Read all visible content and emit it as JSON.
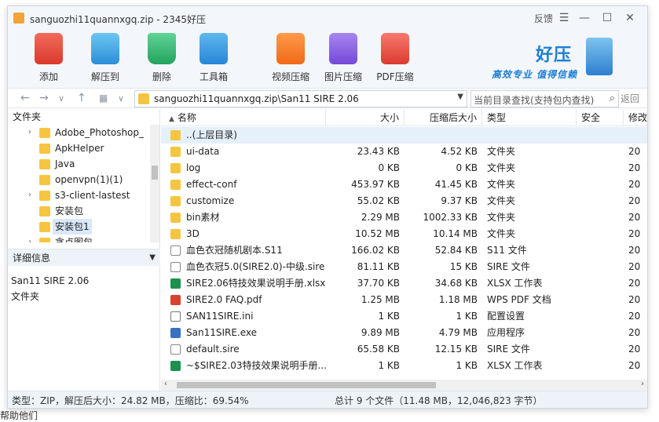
{
  "window": {
    "title": "sanguozhi11quannxgq.zip - 2345好压",
    "feedback": "反馈"
  },
  "toolbar": {
    "items": [
      {
        "label": "添加",
        "icon": "add-icon",
        "color": "#e1483a"
      },
      {
        "label": "解压到",
        "icon": "extract-icon",
        "color": "#37a3e6"
      },
      {
        "label": "删除",
        "icon": "recycle-icon",
        "color": "#2fb36b"
      },
      {
        "label": "工具箱",
        "icon": "toolbox-icon",
        "color": "#2f9be0"
      },
      {
        "label": "视频压缩",
        "icon": "video-compress-icon",
        "color": "#f0701e"
      },
      {
        "label": "图片压缩",
        "icon": "image-compress-icon",
        "color": "#8a5be0"
      },
      {
        "label": "PDF压缩",
        "icon": "pdf-compress-icon",
        "color": "#e6453b"
      }
    ],
    "brand": {
      "name": "好压",
      "slogan": "高效专业 值得信赖"
    }
  },
  "address": {
    "path": "sanguozhi11quannxgq.zip\\San11 SIRE 2.06",
    "search_placeholder": "当前目录查找(支持包内查找)",
    "back_label": "返回"
  },
  "left_pane": {
    "header": "文件夹",
    "tree": [
      {
        "label": "Adobe_Photoshop_",
        "arrow": "›"
      },
      {
        "label": "ApkHelper",
        "arrow": ""
      },
      {
        "label": "Java",
        "arrow": ""
      },
      {
        "label": "openvpn(1)(1)",
        "arrow": ""
      },
      {
        "label": "s3-client-lastest",
        "arrow": "›"
      },
      {
        "label": "安装包",
        "arrow": ""
      },
      {
        "label": "安装包1",
        "arrow": "",
        "selected": true
      },
      {
        "label": "贪点图包",
        "arrow": "›"
      }
    ],
    "detail_header": "详细信息",
    "detail_name": "San11 SIRE 2.06",
    "detail_type": "文件夹"
  },
  "list": {
    "columns": [
      "名称",
      "大小",
      "压缩后大小",
      "类型",
      "安全",
      "修改"
    ],
    "rows": [
      {
        "name": "..(上层目录)",
        "size": "",
        "packed": "",
        "type": "",
        "mod": "",
        "icon": "folder"
      },
      {
        "name": "ui-data",
        "size": "23.43 KB",
        "packed": "4.52 KB",
        "type": "文件夹",
        "mod": "20",
        "icon": "folder"
      },
      {
        "name": "log",
        "size": "0 KB",
        "packed": "0 KB",
        "type": "文件夹",
        "mod": "20",
        "icon": "folder"
      },
      {
        "name": "effect-conf",
        "size": "453.97 KB",
        "packed": "41.45 KB",
        "type": "文件夹",
        "mod": "20",
        "icon": "folder"
      },
      {
        "name": "customize",
        "size": "55.02 KB",
        "packed": "9.37 KB",
        "type": "文件夹",
        "mod": "20",
        "icon": "folder"
      },
      {
        "name": "bin素材",
        "size": "2.29 MB",
        "packed": "1002.33 KB",
        "type": "文件夹",
        "mod": "20",
        "icon": "folder"
      },
      {
        "name": "3D",
        "size": "10.52 MB",
        "packed": "10.14 MB",
        "type": "文件夹",
        "mod": "20",
        "icon": "folder"
      },
      {
        "name": "血色衣冠随机剧本.S11",
        "size": "166.02 KB",
        "packed": "52.84 KB",
        "type": "S11 文件",
        "mod": "20",
        "icon": "doc"
      },
      {
        "name": "血色衣冠5.0(SIRE2.0)-中级.sire",
        "size": "81.11 KB",
        "packed": "15 KB",
        "type": "SIRE 文件",
        "mod": "20",
        "icon": "doc"
      },
      {
        "name": "SIRE2.06特技效果说明手册.xlsx",
        "size": "37.70 KB",
        "packed": "34.68 KB",
        "type": "XLSX 工作表",
        "mod": "20",
        "icon": "xls"
      },
      {
        "name": "SIRE2.0 FAQ.pdf",
        "size": "1.25 MB",
        "packed": "1.18 MB",
        "type": "WPS PDF 文档",
        "mod": "20",
        "icon": "pdf"
      },
      {
        "name": "SAN11SIRE.ini",
        "size": "1 KB",
        "packed": "1 KB",
        "type": "配置设置",
        "mod": "20",
        "icon": "ini"
      },
      {
        "name": "San11SIRE.exe",
        "size": "9.89 MB",
        "packed": "4.79 MB",
        "type": "应用程序",
        "mod": "20",
        "icon": "exe"
      },
      {
        "name": "default.sire",
        "size": "65.58 KB",
        "packed": "12.15 KB",
        "type": "SIRE 文件",
        "mod": "20",
        "icon": "doc"
      },
      {
        "name": "~$SIRE2.03特技效果说明手册....",
        "size": "1 KB",
        "packed": "1 KB",
        "type": "XLSX 工作表",
        "mod": "20",
        "icon": "xls"
      }
    ]
  },
  "status": {
    "left": "类型：ZIP，解压后大小：24.82 MB，压缩比：69.54%",
    "right": "总计 9 个文件（11.48 MB，12,046,823 字节）"
  },
  "background": {
    "bottom_text": "帮助他们"
  }
}
